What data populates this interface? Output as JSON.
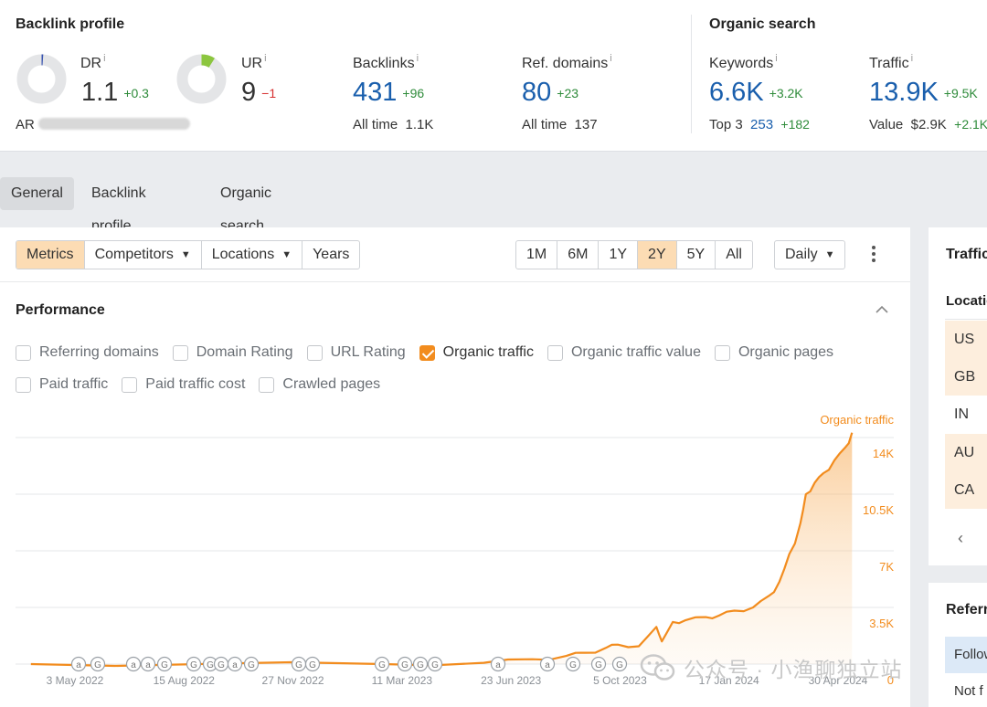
{
  "backlink_profile": {
    "title": "Backlink profile",
    "dr": {
      "label": "DR",
      "info": "i",
      "value": "1.1",
      "delta": "+0.3",
      "gauge_fraction": 0.011
    },
    "ur": {
      "label": "UR",
      "info": "i",
      "value": "9",
      "delta": "−1",
      "gauge_fraction": 0.09
    },
    "ar": {
      "label": "AR"
    },
    "backlinks": {
      "label": "Backlinks",
      "info": "i",
      "value": "431",
      "delta": "+96",
      "sub_label": "All time",
      "sub_value": "1.1K"
    },
    "ref_domains": {
      "label": "Ref. domains",
      "info": "i",
      "value": "80",
      "delta": "+23",
      "sub_label": "All time",
      "sub_value": "137"
    }
  },
  "organic_search": {
    "title": "Organic search",
    "keywords": {
      "label": "Keywords",
      "info": "i",
      "value": "6.6K",
      "delta": "+3.2K",
      "sub_label": "Top 3",
      "sub_value": "253",
      "sub_delta": "+182"
    },
    "traffic": {
      "label": "Traffic",
      "info": "i",
      "value": "13.9K",
      "delta": "+9.5K",
      "sub_label": "Value",
      "sub_value": "$2.9K",
      "sub_delta": "+2.1K"
    }
  },
  "nav": {
    "tabs": [
      "General",
      "Backlink profile",
      "Organic search"
    ],
    "active": "General"
  },
  "toolbar": {
    "metrics": "Metrics",
    "competitors": "Competitors",
    "locations": "Locations",
    "years": "Years",
    "ranges": [
      "1M",
      "6M",
      "1Y",
      "2Y",
      "5Y",
      "All"
    ],
    "active_range": "2Y",
    "interval": "Daily"
  },
  "performance": {
    "title": "Performance",
    "checkboxes_row1": [
      {
        "label": "Referring domains",
        "checked": false
      },
      {
        "label": "Domain Rating",
        "checked": false
      },
      {
        "label": "URL Rating",
        "checked": false
      },
      {
        "label": "Organic traffic",
        "checked": true
      },
      {
        "label": "Organic traffic value",
        "checked": false
      },
      {
        "label": "Organic pages",
        "checked": false
      }
    ],
    "checkboxes_row2": [
      {
        "label": "Paid traffic",
        "checked": false
      },
      {
        "label": "Paid traffic cost",
        "checked": false
      },
      {
        "label": "Crawled pages",
        "checked": false
      }
    ]
  },
  "chart_data": {
    "type": "area",
    "series": [
      {
        "name": "Organic traffic",
        "x": [
          "2022-04-15",
          "2022-09-15",
          "2023-03-01",
          "2023-06-01",
          "2023-07-15",
          "2023-08-15",
          "2023-09-01",
          "2023-09-20",
          "2023-10-01",
          "2023-10-20",
          "2023-11-05",
          "2023-11-10",
          "2023-11-20",
          "2023-12-01",
          "2023-12-20",
          "2024-01-01",
          "2024-01-15",
          "2024-02-01",
          "2024-02-15",
          "2024-02-25",
          "2024-03-05",
          "2024-03-15",
          "2024-03-20",
          "2024-03-28",
          "2024-04-05",
          "2024-04-15",
          "2024-04-25",
          "2024-05-01"
        ],
        "values": [
          0,
          0,
          0,
          80,
          300,
          500,
          700,
          1000,
          1200,
          1100,
          2300,
          1400,
          2600,
          2700,
          2900,
          3000,
          3300,
          3500,
          4200,
          5100,
          6800,
          8700,
          10500,
          11200,
          11800,
          12600,
          13400,
          14300
        ]
      }
    ],
    "xticks": [
      "3 May 2022",
      "15 Aug 2022",
      "27 Nov 2022",
      "11 Mar 2023",
      "23 Jun 2023",
      "5 Oct 2023",
      "17 Jan 2024",
      "30 Apr 2024"
    ],
    "yticks": [
      "0",
      "3.5K",
      "7K",
      "10.5K",
      "14K"
    ],
    "ylim": [
      0,
      14000
    ],
    "legend_label": "Organic traffic",
    "event_markers": [
      "a",
      "G",
      "a",
      "a",
      "G",
      "G",
      "G",
      "G",
      "a",
      "G",
      "G",
      "G",
      "G",
      "G",
      "G",
      "G",
      "a",
      "a",
      "G",
      "G",
      "G"
    ],
    "color": "#f28c1e"
  },
  "right_panel": {
    "title": "Traffic",
    "locations_label": "Location",
    "locations": [
      "US",
      "GB",
      "IN",
      "AU",
      "CA"
    ],
    "referring_title": "Referring",
    "referring_rows": [
      "Follow",
      "Not f"
    ]
  },
  "watermark": {
    "text": "公众号 · 小渔聊独立站"
  }
}
